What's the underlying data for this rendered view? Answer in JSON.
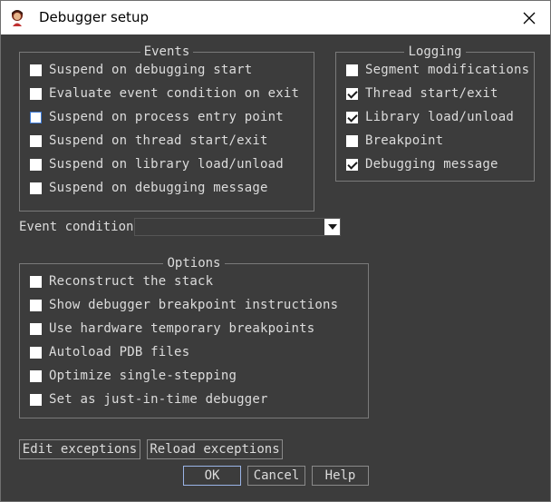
{
  "window": {
    "title": "Debugger setup"
  },
  "events": {
    "legend": "Events",
    "items": [
      {
        "label": "Suspend on debugging start",
        "checked": false
      },
      {
        "label": "Evaluate event condition on exit",
        "checked": false
      },
      {
        "label": "Suspend on process entry point",
        "checked": false,
        "focused": true
      },
      {
        "label": "Suspend on thread start/exit",
        "checked": false
      },
      {
        "label": "Suspend on library load/unload",
        "checked": false
      },
      {
        "label": "Suspend on debugging message",
        "checked": false
      }
    ]
  },
  "logging": {
    "legend": "Logging",
    "items": [
      {
        "label": "Segment modifications",
        "checked": false
      },
      {
        "label": "Thread start/exit",
        "checked": true
      },
      {
        "label": "Library load/unload",
        "checked": true
      },
      {
        "label": "Breakpoint",
        "checked": false
      },
      {
        "label": "Debugging message",
        "checked": true
      }
    ]
  },
  "event_condition": {
    "label": "Event condition",
    "value": ""
  },
  "options": {
    "legend": "Options",
    "items": [
      {
        "label": "Reconstruct the stack",
        "checked": false
      },
      {
        "label": "Show debugger breakpoint instructions",
        "checked": false
      },
      {
        "label": "Use hardware temporary breakpoints",
        "checked": false
      },
      {
        "label": "Autoload PDB files",
        "checked": false
      },
      {
        "label": "Optimize single-stepping",
        "checked": false
      },
      {
        "label": "Set as just-in-time debugger",
        "checked": false
      }
    ]
  },
  "buttons": {
    "edit_exceptions": "Edit exceptions",
    "reload_exceptions": "Reload exceptions",
    "ok": "OK",
    "cancel": "Cancel",
    "help": "Help"
  },
  "colors": {
    "dialog_bg": "#3c3c3c",
    "titlebar_bg": "#ffffff",
    "focus": "#3d7ad6"
  }
}
